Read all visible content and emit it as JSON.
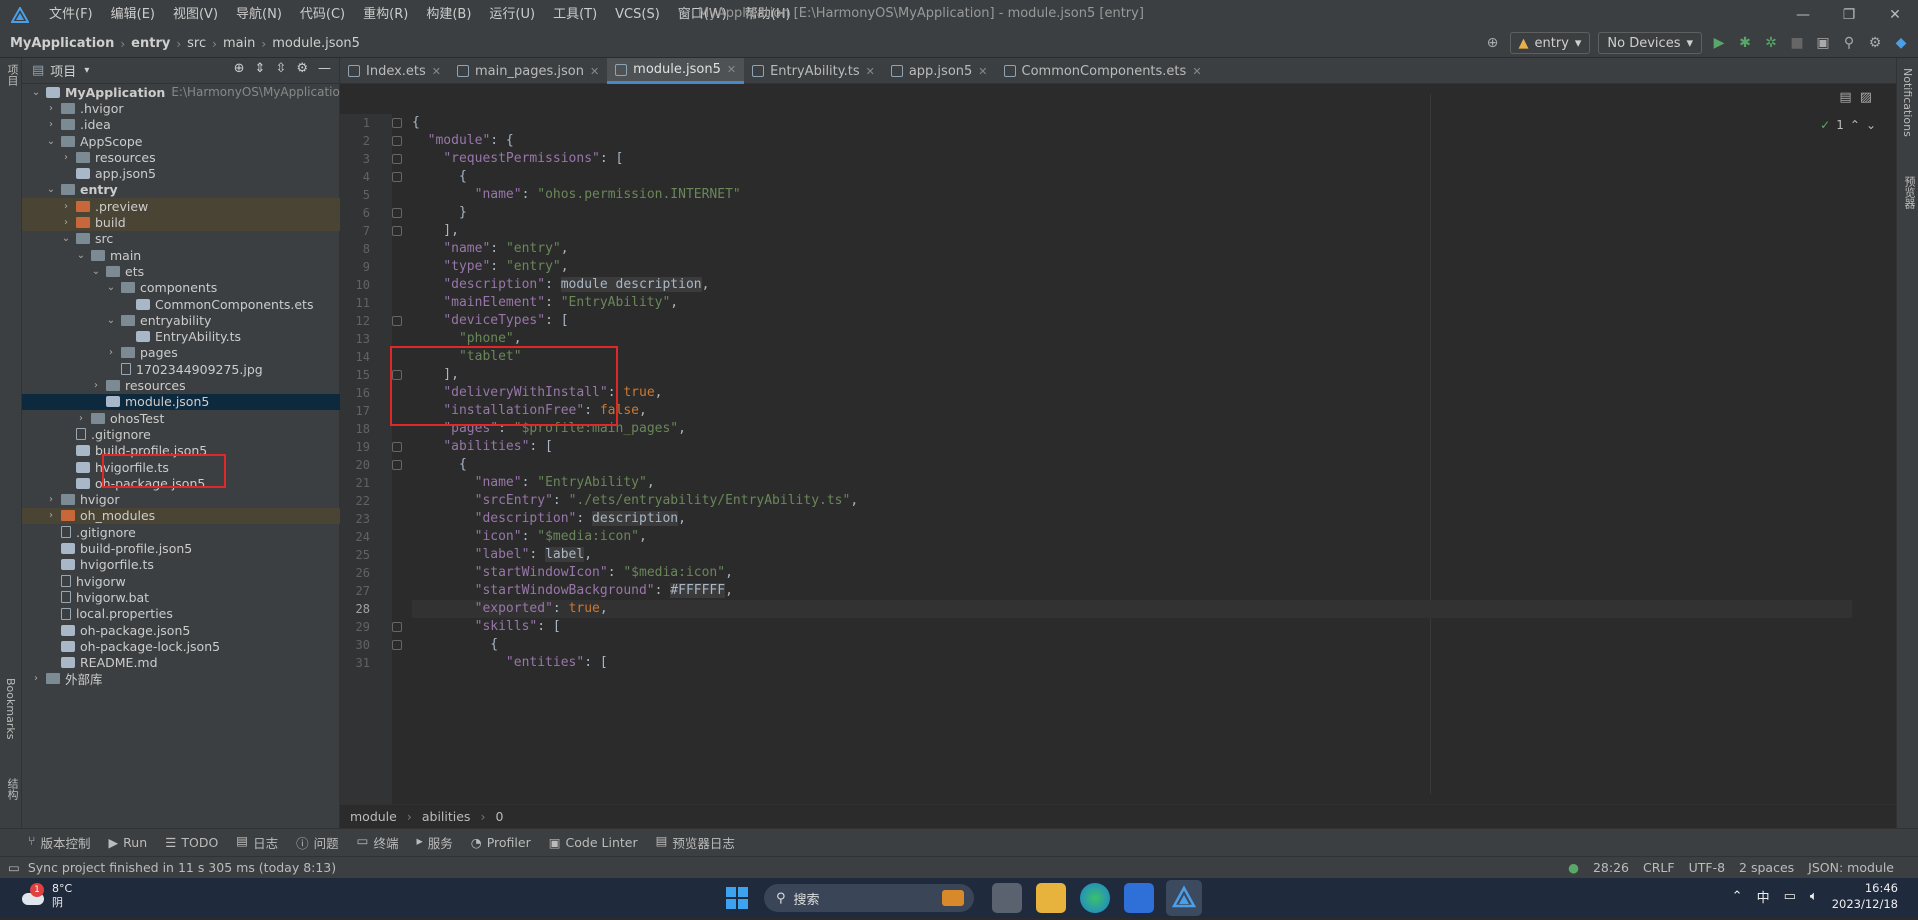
{
  "titlebar": {
    "menu": [
      "文件(F)",
      "编辑(E)",
      "视图(V)",
      "导航(N)",
      "代码(C)",
      "重构(R)",
      "构建(B)",
      "运行(U)",
      "工具(T)",
      "VCS(S)",
      "窗口(W)",
      "帮助(H)"
    ],
    "title": "MyApplication [E:\\HarmonyOS\\MyApplication] - module.json5 [entry]"
  },
  "navbar": {
    "crumbs": [
      "MyApplication",
      "entry",
      "src",
      "main",
      "module.json5"
    ],
    "run_config": "entry",
    "device": "No Devices"
  },
  "project": {
    "header": "项目",
    "tree": [
      {
        "label": "MyApplication",
        "path": "E:\\HarmonyOS\\MyApplicatio",
        "depth": 0,
        "arrow": "down",
        "icon": "module",
        "bold": true
      },
      {
        "label": ".hvigor",
        "depth": 1,
        "arrow": "right",
        "icon": "folder"
      },
      {
        "label": ".idea",
        "depth": 1,
        "arrow": "right",
        "icon": "folder"
      },
      {
        "label": "AppScope",
        "depth": 1,
        "arrow": "down",
        "icon": "folder"
      },
      {
        "label": "resources",
        "depth": 2,
        "arrow": "right",
        "icon": "folder"
      },
      {
        "label": "app.json5",
        "depth": 2,
        "arrow": "",
        "icon": "module"
      },
      {
        "label": "entry",
        "depth": 1,
        "arrow": "down",
        "icon": "folder",
        "bold": true
      },
      {
        "label": ".preview",
        "depth": 2,
        "arrow": "right",
        "icon": "orange",
        "excluded": true
      },
      {
        "label": "build",
        "depth": 2,
        "arrow": "right",
        "icon": "orange",
        "excluded": true
      },
      {
        "label": "src",
        "depth": 2,
        "arrow": "down",
        "icon": "folder"
      },
      {
        "label": "main",
        "depth": 3,
        "arrow": "down",
        "icon": "folder"
      },
      {
        "label": "ets",
        "depth": 4,
        "arrow": "down",
        "icon": "folder"
      },
      {
        "label": "components",
        "depth": 5,
        "arrow": "down",
        "icon": "folder"
      },
      {
        "label": "CommonComponents.ets",
        "depth": 6,
        "arrow": "",
        "icon": "module"
      },
      {
        "label": "entryability",
        "depth": 5,
        "arrow": "down",
        "icon": "folder"
      },
      {
        "label": "EntryAbility.ts",
        "depth": 6,
        "arrow": "",
        "icon": "module"
      },
      {
        "label": "pages",
        "depth": 5,
        "arrow": "right",
        "icon": "folder"
      },
      {
        "label": "1702344909275.jpg",
        "depth": 5,
        "arrow": "",
        "icon": "file"
      },
      {
        "label": "resources",
        "depth": 4,
        "arrow": "right",
        "icon": "folder"
      },
      {
        "label": "module.json5",
        "depth": 4,
        "arrow": "",
        "icon": "module",
        "selected": true
      },
      {
        "label": "ohosTest",
        "depth": 3,
        "arrow": "right",
        "icon": "folder"
      },
      {
        "label": ".gitignore",
        "depth": 2,
        "arrow": "",
        "icon": "file"
      },
      {
        "label": "build-profile.json5",
        "depth": 2,
        "arrow": "",
        "icon": "module"
      },
      {
        "label": "hvigorfile.ts",
        "depth": 2,
        "arrow": "",
        "icon": "module"
      },
      {
        "label": "oh-package.json5",
        "depth": 2,
        "arrow": "",
        "icon": "module"
      },
      {
        "label": "hvigor",
        "depth": 1,
        "arrow": "right",
        "icon": "folder"
      },
      {
        "label": "oh_modules",
        "depth": 1,
        "arrow": "right",
        "icon": "orange",
        "excluded": true
      },
      {
        "label": ".gitignore",
        "depth": 1,
        "arrow": "",
        "icon": "file"
      },
      {
        "label": "build-profile.json5",
        "depth": 1,
        "arrow": "",
        "icon": "module"
      },
      {
        "label": "hvigorfile.ts",
        "depth": 1,
        "arrow": "",
        "icon": "module"
      },
      {
        "label": "hvigorw",
        "depth": 1,
        "arrow": "",
        "icon": "file"
      },
      {
        "label": "hvigorw.bat",
        "depth": 1,
        "arrow": "",
        "icon": "file"
      },
      {
        "label": "local.properties",
        "depth": 1,
        "arrow": "",
        "icon": "file"
      },
      {
        "label": "oh-package.json5",
        "depth": 1,
        "arrow": "",
        "icon": "module"
      },
      {
        "label": "oh-package-lock.json5",
        "depth": 1,
        "arrow": "",
        "icon": "module"
      },
      {
        "label": "README.md",
        "depth": 1,
        "arrow": "",
        "icon": "module"
      },
      {
        "label": "外部库",
        "depth": 0,
        "arrow": "right",
        "icon": "folder"
      }
    ]
  },
  "tabs": [
    "Index.ets",
    "main_pages.json",
    "module.json5",
    "EntryAbility.ts",
    "app.json5",
    "CommonComponents.ets"
  ],
  "active_tab": "module.json5",
  "editor": {
    "inspection_count": "1",
    "current_line": 28,
    "lines": [
      "{",
      "  \"module\": {",
      "    \"requestPermissions\": [",
      "      {",
      "        \"name\": \"ohos.permission.INTERNET\"",
      "      }",
      "    ],",
      "    \"name\": \"entry\",",
      "    \"type\": \"entry\",",
      "    \"description\": module description,",
      "    \"mainElement\": \"EntryAbility\",",
      "    \"deviceTypes\": [",
      "      \"phone\",",
      "      \"tablet\"",
      "    ],",
      "    \"deliveryWithInstall\": true,",
      "    \"installationFree\": false,",
      "    \"pages\": \"$profile:main_pages\",",
      "    \"abilities\": [",
      "      {",
      "        \"name\": \"EntryAbility\",",
      "        \"srcEntry\": \"./ets/entryability/EntryAbility.ts\",",
      "        \"description\": description,",
      "        \"icon\": \"$media:icon\",",
      "        \"label\": label,",
      "        \"startWindowIcon\": \"$media:icon\",",
      "        \"startWindowBackground\": #FFFFFF,",
      "        \"exported\": true,",
      "        \"skills\": [",
      "          {",
      "            \"entities\": ["
    ],
    "breadcrumb": [
      "module",
      "abilities",
      "0"
    ]
  },
  "toolwindows": [
    "版本控制",
    "Run",
    "TODO",
    "日志",
    "问题",
    "终端",
    "服务",
    "Profiler",
    "Code Linter",
    "预览器日志"
  ],
  "left_strip": [
    "项目",
    "Bookmarks",
    "结构"
  ],
  "right_strip": [
    "Notifications",
    "预览器"
  ],
  "status": {
    "message": "Sync project finished in 11 s 305 ms (today 8:13)",
    "position": "28:26",
    "line_sep": "CRLF",
    "encoding": "UTF-8",
    "indent": "2 spaces",
    "schema": "JSON: module"
  },
  "taskbar": {
    "weather_temp": "8°C",
    "weather_desc": "阴",
    "weather_badge": "1",
    "search": "搜索",
    "ime": "中",
    "time": "16:46",
    "date": "2023/12/18"
  }
}
